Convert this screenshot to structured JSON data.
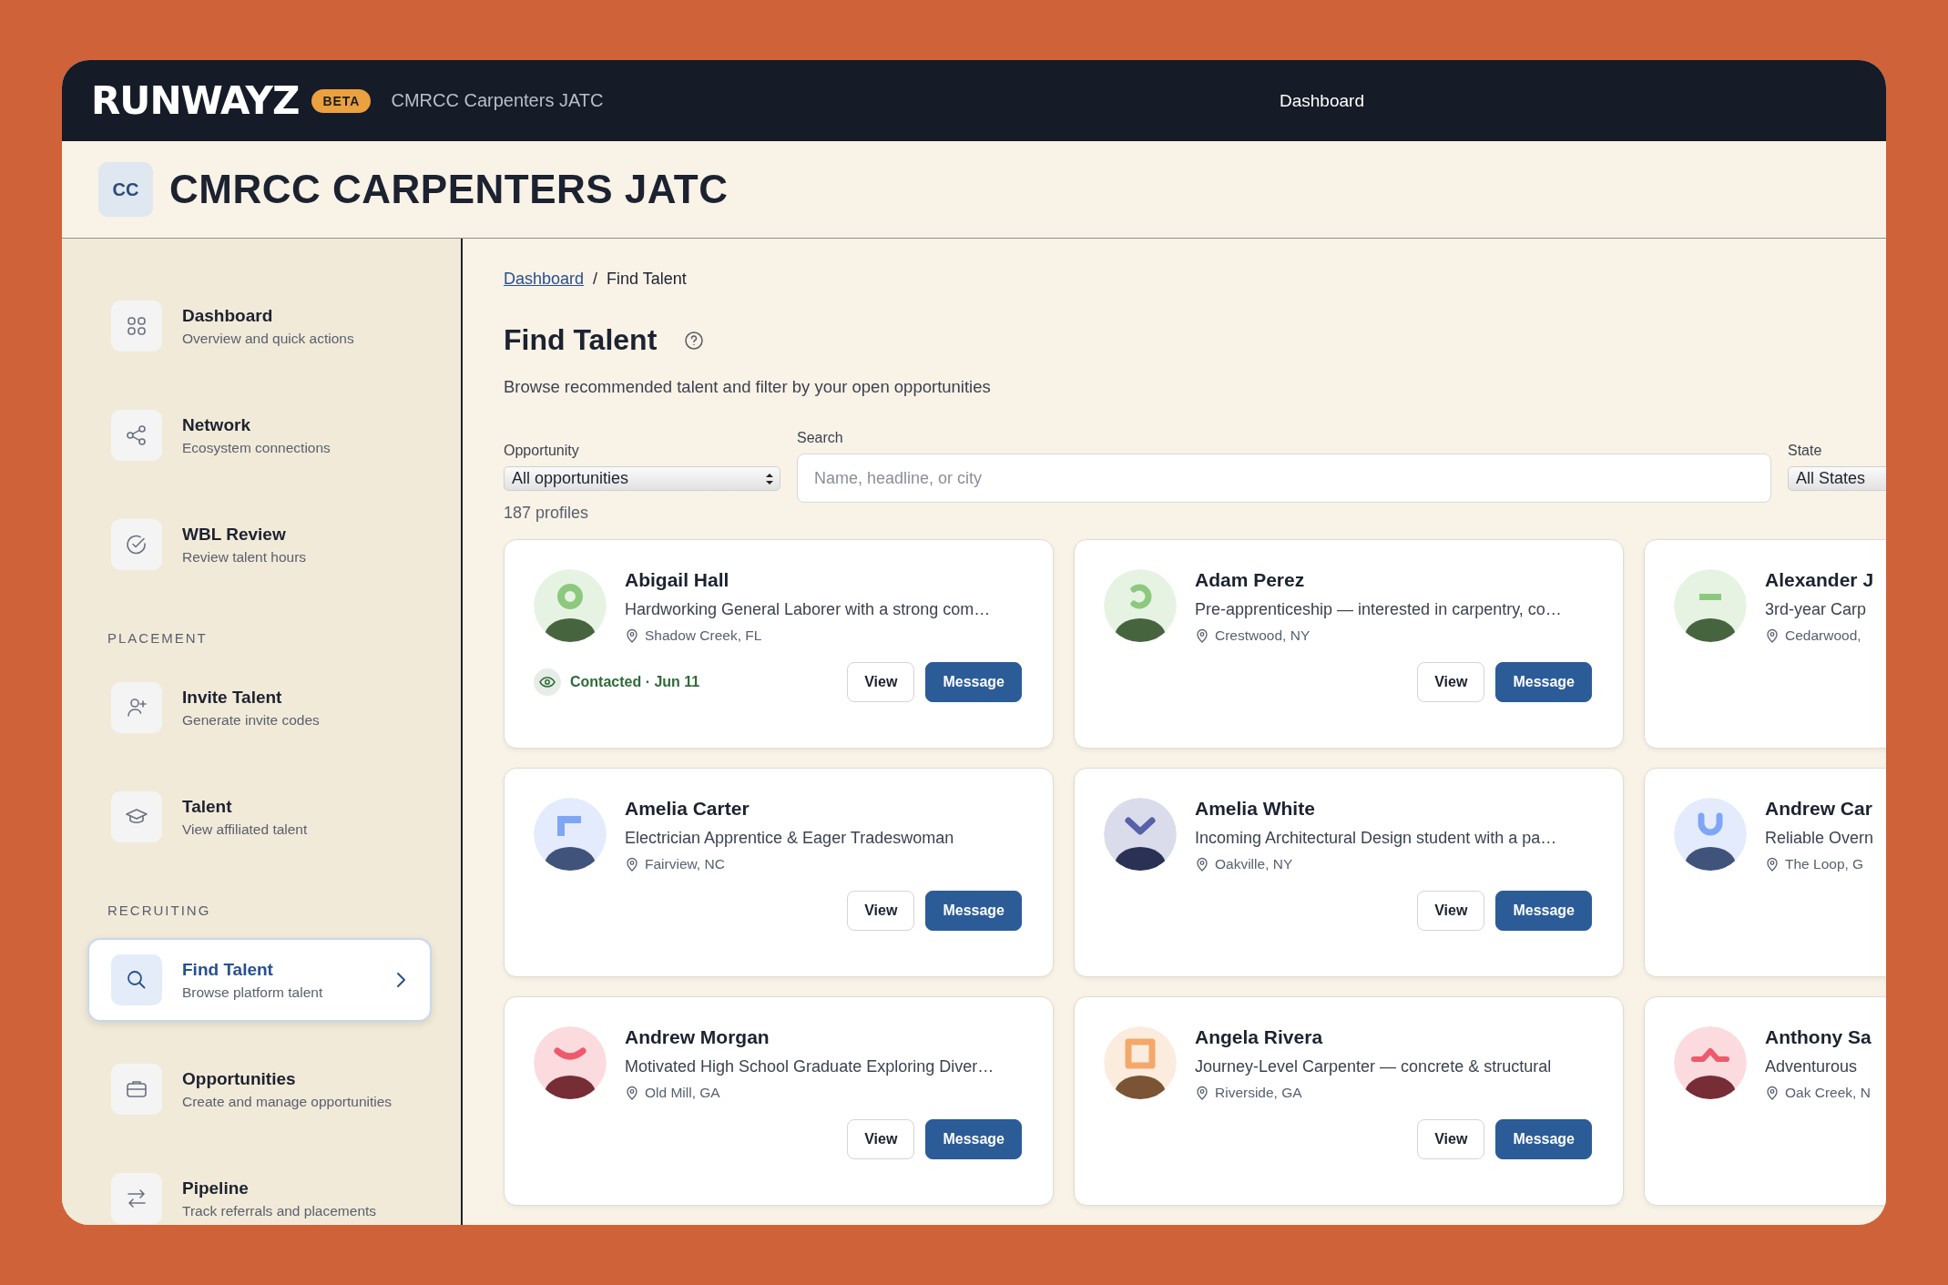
{
  "topbar": {
    "logo": "RUNWAYZ",
    "badge": "BETA",
    "org": "CMRCC Carpenters JATC",
    "center": "Dashboard"
  },
  "org_header": {
    "initials": "CC",
    "title": "CMRCC CARPENTERS JATC"
  },
  "sidebar": {
    "sections": [
      {
        "items": [
          {
            "title": "Dashboard",
            "subtitle": "Overview and quick actions",
            "selected": false
          },
          {
            "title": "Network",
            "subtitle": "Ecosystem connections",
            "selected": false
          },
          {
            "title": "WBL Review",
            "subtitle": "Review talent hours",
            "selected": false
          }
        ]
      },
      {
        "heading": "PLACEMENT",
        "items": [
          {
            "title": "Invite Talent",
            "subtitle": "Generate invite codes",
            "selected": false
          },
          {
            "title": "Talent",
            "subtitle": "View affiliated talent",
            "selected": false
          }
        ]
      },
      {
        "heading": "RECRUITING",
        "items": [
          {
            "title": "Find Talent",
            "subtitle": "Browse platform talent",
            "selected": true
          },
          {
            "title": "Opportunities",
            "subtitle": "Create and manage opportunities",
            "selected": false
          },
          {
            "title": "Pipeline",
            "subtitle": "Track referrals and placements",
            "selected": false
          }
        ]
      }
    ]
  },
  "breadcrumb": {
    "link": "Dashboard",
    "separator": "/",
    "current": "Find Talent"
  },
  "page": {
    "title": "Find Talent",
    "subtitle": "Browse recommended talent and filter by your open opportunities"
  },
  "filters": {
    "opportunity": {
      "label": "Opportunity",
      "value": "All opportunities"
    },
    "search": {
      "label": "Search",
      "placeholder": "Name, headline, or city"
    },
    "state": {
      "label": "State",
      "value": "All States"
    }
  },
  "count": "187 profiles",
  "cards": [
    {
      "name": "Abigail Hall",
      "headline": "Hardworking General Laborer with a strong com…",
      "location": "Shadow Creek, FL",
      "color": "#8cc97e",
      "status": "Contacted · Jun 11",
      "buttons": [
        "View",
        "Message"
      ]
    },
    {
      "name": "Adam Perez",
      "headline": "Pre-apprenticeship — interested in carpentry, co…",
      "location": "Crestwood, NY",
      "color": "#8cc97e",
      "buttons": [
        "View",
        "Message"
      ]
    },
    {
      "name": "Alexander J",
      "headline": "3rd-year Carp",
      "location": "Cedarwood,",
      "color": "#8cc97e"
    },
    {
      "name": "Amelia Carter",
      "headline": "Electrician Apprentice & Eager Tradeswoman",
      "location": "Fairview, NC",
      "color": "#7fa6f5",
      "buttons": [
        "View",
        "Message"
      ]
    },
    {
      "name": "Amelia White",
      "headline": "Incoming Architectural Design student with a pa…",
      "location": "Oakville, NY",
      "color": "#5661a8",
      "buttons": [
        "View",
        "Message"
      ]
    },
    {
      "name": "Andrew Car",
      "headline": "Reliable Overn",
      "location": "The Loop, G",
      "color": "#7fa6f5"
    },
    {
      "name": "Andrew Morgan",
      "headline": "Motivated High School Graduate Exploring Diver…",
      "location": "Old Mill, GA",
      "color": "#ee5a6b",
      "buttons": [
        "View",
        "Message"
      ]
    },
    {
      "name": "Angela Rivera",
      "headline": "Journey-Level Carpenter — concrete & structural",
      "location": "Riverside, GA",
      "color": "#f3a86a",
      "buttons": [
        "View",
        "Message"
      ]
    },
    {
      "name": "Anthony Sa",
      "headline": "Adventurous",
      "location": "Oak Creek, N",
      "color": "#ee5a6b"
    }
  ]
}
